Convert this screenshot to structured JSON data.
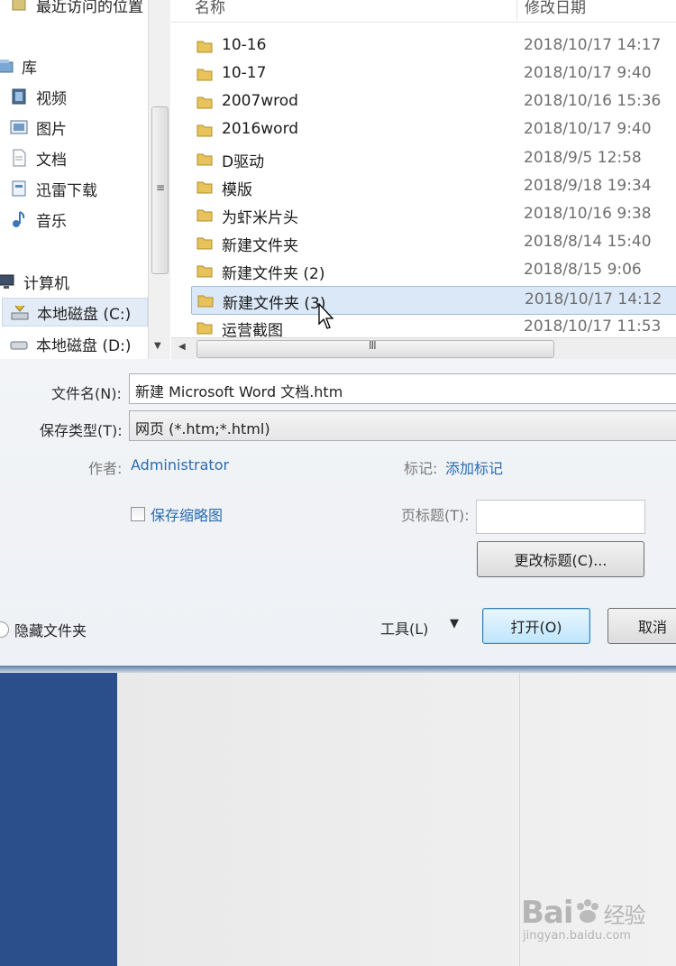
{
  "nav": {
    "items": [
      {
        "label": "最近访问的位置",
        "icon": "recent-places-icon"
      },
      {
        "label": "库",
        "icon": "library-icon"
      },
      {
        "label": "视频",
        "icon": "video-icon"
      },
      {
        "label": "图片",
        "icon": "pictures-icon"
      },
      {
        "label": "文档",
        "icon": "documents-icon"
      },
      {
        "label": "迅雷下载",
        "icon": "download-icon"
      },
      {
        "label": "音乐",
        "icon": "music-icon"
      },
      {
        "label": "计算机",
        "icon": "computer-icon"
      },
      {
        "label": "本地磁盘 (C:)",
        "icon": "drive-c-icon"
      },
      {
        "label": "本地磁盘 (D:)",
        "icon": "drive-d-icon"
      }
    ]
  },
  "list": {
    "header_name": "名称",
    "header_date": "修改日期",
    "rows": [
      {
        "name": "10-16",
        "date": "2018/10/17 14:17"
      },
      {
        "name": "10-17",
        "date": "2018/10/17 9:40"
      },
      {
        "name": "2007wrod",
        "date": "2018/10/16 15:36"
      },
      {
        "name": "2016word",
        "date": "2018/10/17 9:40"
      },
      {
        "name": "D驱动",
        "date": "2018/9/5 12:58"
      },
      {
        "name": "模版",
        "date": "2018/9/18 19:34"
      },
      {
        "name": "为虾米片头",
        "date": "2018/10/16 9:38"
      },
      {
        "name": "新建文件夹",
        "date": "2018/8/14 15:40"
      },
      {
        "name": "新建文件夹 (2)",
        "date": "2018/8/15 9:06"
      },
      {
        "name": "新建文件夹 (3)",
        "date": "2018/10/17 14:12"
      },
      {
        "name": "运营截图",
        "date": "2018/10/17 11:53"
      }
    ],
    "hscroll_grip": "III"
  },
  "form": {
    "filename_label": "文件名(N):",
    "filename_value": "新建 Microsoft Word 文档.htm",
    "filetype_label": "保存类型(T):",
    "filetype_value": "网页 (*.htm;*.html)",
    "author_label": "作者:",
    "author_value": "Administrator",
    "tags_label": "标记:",
    "tags_value": "添加标记",
    "thumbnail_label": "保存缩略图",
    "page_title_label": "页标题(T):",
    "page_title_value": "",
    "change_title_button": "更改标题(C)...",
    "hide_folders": "隐藏文件夹",
    "tools_button": "工具(L)",
    "open_button": "打开(O)",
    "cancel_button": "取消"
  },
  "watermark": {
    "brand": "Bai",
    "brand_suffix": "经验",
    "url": "jingyan.baidu.com"
  },
  "colors": {
    "selection": "#dbe8f7",
    "link": "#2a6bb0",
    "folder": "#e8c25a",
    "ribbon_side": "#2b4f8a"
  }
}
